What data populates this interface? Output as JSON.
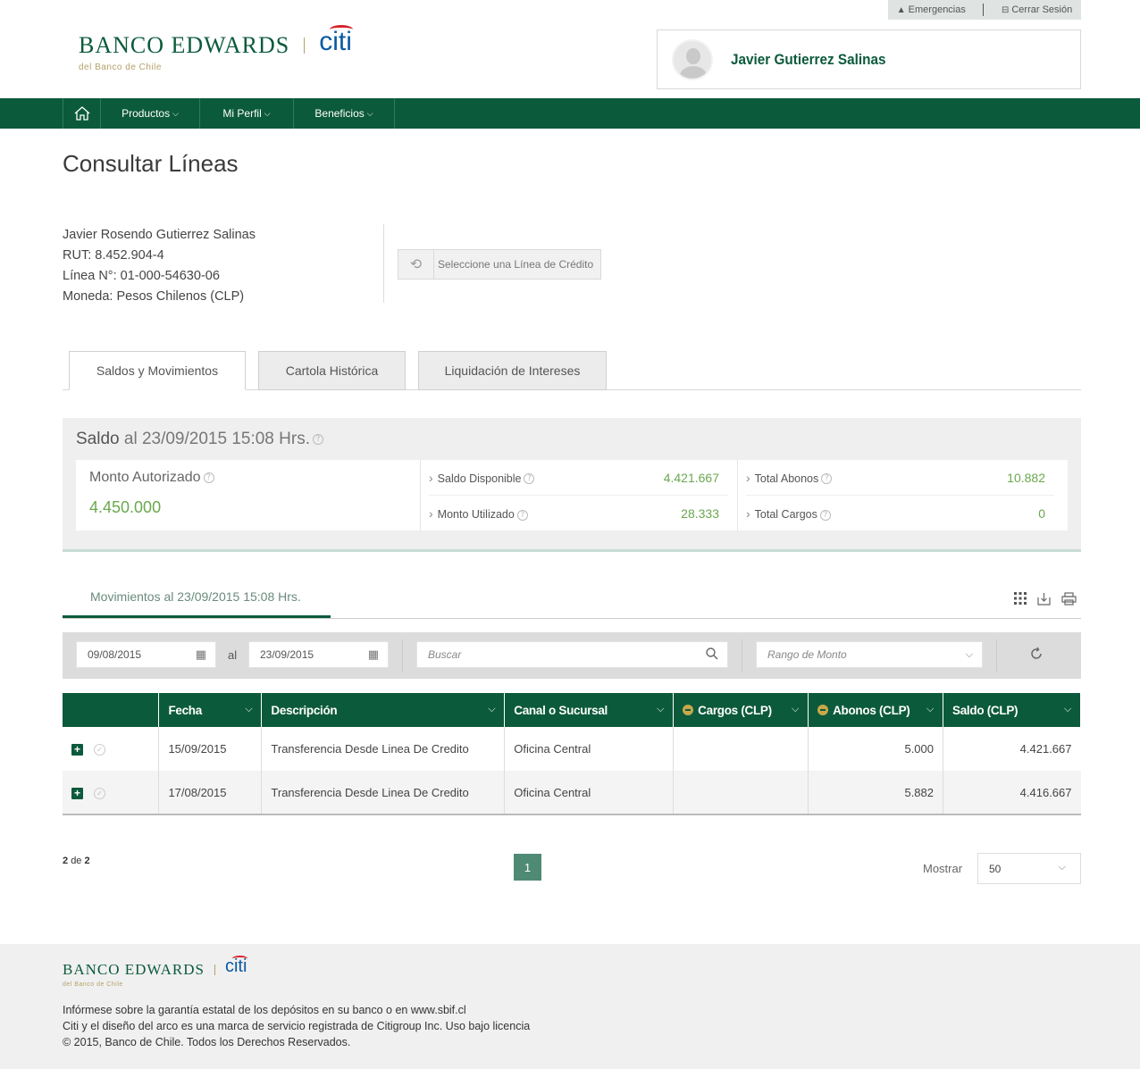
{
  "topbar": {
    "emergencias": "Emergencias",
    "cerrar_sesion": "Cerrar Sesión"
  },
  "brand": {
    "name": "BANCO EDWARDS",
    "partner": "citi",
    "sub": "del Banco de Chile",
    "colors": {
      "primary": "#0c5a3c",
      "gold": "#b5a16a",
      "citi_blue": "#0a5aa0",
      "citi_red": "#d6232b",
      "positive": "#6aa84f"
    }
  },
  "user": {
    "name": "Javier Gutierrez Salinas"
  },
  "nav": {
    "home_icon": "home-icon",
    "items": [
      {
        "label": "Productos"
      },
      {
        "label": "Mi Perfil"
      },
      {
        "label": "Beneficios"
      }
    ]
  },
  "page": {
    "title": "Consultar Líneas"
  },
  "account": {
    "holder": "Javier Rosendo Gutierrez Salinas",
    "rut": "RUT: 8.452.904-4",
    "linea": "Línea N°: 01-000-54630-06",
    "moneda": "Moneda: Pesos Chilenos (CLP)",
    "select_line_label": "Seleccione una Línea de Crédito"
  },
  "tabs": [
    {
      "label": "Saldos y Movimientos",
      "active": true
    },
    {
      "label": "Cartola Histórica",
      "active": false
    },
    {
      "label": "Liquidación de Intereses",
      "active": false
    }
  ],
  "saldo": {
    "title_prefix": "Saldo",
    "title_rest": "al 23/09/2015 15:08 Hrs.",
    "monto_autorizado_label": "Monto Autorizado",
    "monto_autorizado_value": "4.450.000",
    "saldo_disponible_label": "Saldo Disponible",
    "saldo_disponible_value": "4.421.667",
    "monto_utilizado_label": "Monto Utilizado",
    "monto_utilizado_value": "28.333",
    "total_abonos_label": "Total Abonos",
    "total_abonos_value": "10.882",
    "total_cargos_label": "Total Cargos",
    "total_cargos_value": "0"
  },
  "movimientos": {
    "title": "Movimientos al 23/09/2015 15:08 Hrs.",
    "tools": [
      "grid-icon",
      "download-icon",
      "print-icon"
    ]
  },
  "filters": {
    "date_from": "09/08/2015",
    "al": "al",
    "date_to": "23/09/2015",
    "search_placeholder": "Buscar",
    "rango_placeholder": "Rango de Monto"
  },
  "table": {
    "headers": {
      "fecha": "Fecha",
      "descripcion": "Descripción",
      "canal": "Canal o Sucursal",
      "cargos": "Cargos (CLP)",
      "abonos": "Abonos (CLP)",
      "saldo": "Saldo (CLP)"
    },
    "rows": [
      {
        "fecha": "15/09/2015",
        "descripcion": "Transferencia Desde Linea De Credito",
        "canal": "Oficina Central",
        "cargos": "",
        "abonos": "5.000",
        "saldo": "4.421.667"
      },
      {
        "fecha": "17/08/2015",
        "descripcion": "Transferencia Desde Linea De Credito",
        "canal": "Oficina Central",
        "cargos": "",
        "abonos": "5.882",
        "saldo": "4.416.667"
      }
    ]
  },
  "pagination": {
    "count_a": "2",
    "count_de": "de",
    "count_b": "2",
    "page": "1",
    "mostrar_label": "Mostrar",
    "mostrar_value": "50"
  },
  "footer": {
    "line1": "Infórmese sobre la garantía estatal de los depósitos en su banco o en www.sbif.cl",
    "line2": "Citi y el diseño del arco es una marca de servicio registrada de Citigroup Inc. Uso bajo licencia",
    "line3": "© 2015, Banco de Chile. Todos los Derechos Reservados."
  }
}
